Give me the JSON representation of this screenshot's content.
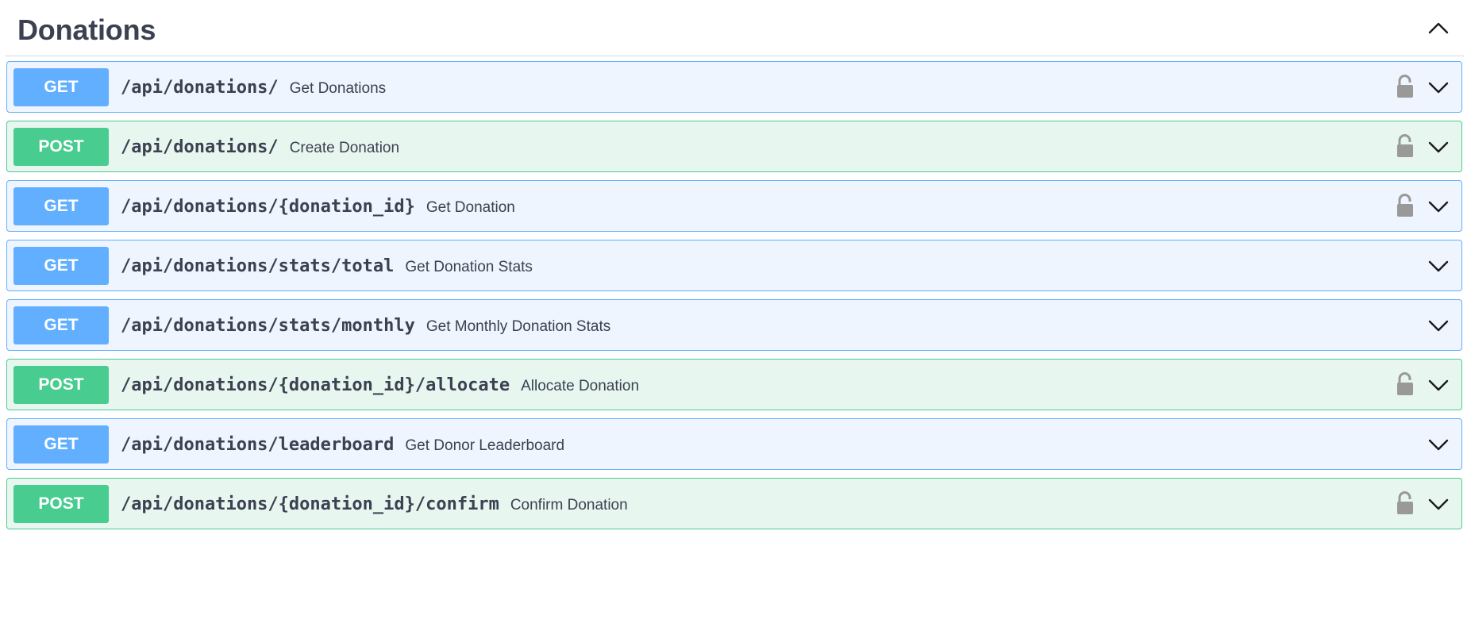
{
  "section": {
    "title": "Donations"
  },
  "icons": {
    "collapse": "chevron-up-icon",
    "expand": "chevron-down-icon",
    "lock": "lock-open-icon"
  },
  "colors": {
    "get": "#61affe",
    "post": "#49cc90",
    "lock": "#999999"
  },
  "operations": [
    {
      "method": "GET",
      "path": "/api/donations/",
      "summary": "Get Donations",
      "locked": true
    },
    {
      "method": "POST",
      "path": "/api/donations/",
      "summary": "Create Donation",
      "locked": true
    },
    {
      "method": "GET",
      "path": "/api/donations/{donation_id}",
      "summary": "Get Donation",
      "locked": true
    },
    {
      "method": "GET",
      "path": "/api/donations/stats/total",
      "summary": "Get Donation Stats",
      "locked": false
    },
    {
      "method": "GET",
      "path": "/api/donations/stats/monthly",
      "summary": "Get Monthly Donation Stats",
      "locked": false
    },
    {
      "method": "POST",
      "path": "/api/donations/{donation_id}/allocate",
      "summary": "Allocate Donation",
      "locked": true
    },
    {
      "method": "GET",
      "path": "/api/donations/leaderboard",
      "summary": "Get Donor Leaderboard",
      "locked": false
    },
    {
      "method": "POST",
      "path": "/api/donations/{donation_id}/confirm",
      "summary": "Confirm Donation",
      "locked": true
    }
  ]
}
